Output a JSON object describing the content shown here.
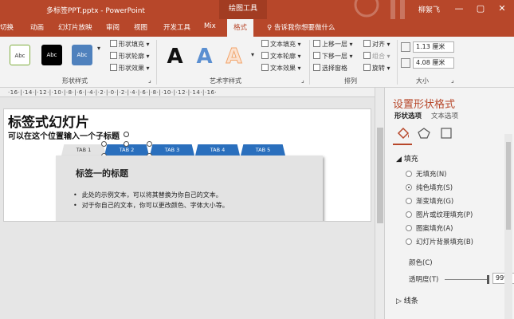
{
  "window": {
    "file_title": "多标签PPT.pptx - PowerPoint",
    "context_tab": "绘图工具",
    "user": "柳絮飞",
    "minimize": "—",
    "restore": "▢",
    "close": "✕"
  },
  "tabs": [
    {
      "label": "切换"
    },
    {
      "label": "动画"
    },
    {
      "label": "幻灯片放映"
    },
    {
      "label": "审阅"
    },
    {
      "label": "视图"
    },
    {
      "label": "开发工具"
    },
    {
      "label": "Mix"
    },
    {
      "label": "格式"
    }
  ],
  "tell_me": "告诉我你想要做什么",
  "ribbon": {
    "shape_styles": {
      "label": "形状样式",
      "swatches": [
        {
          "text": "Abc",
          "bg": "#ffffff",
          "fg": "#333333",
          "border": "#7fae3f"
        },
        {
          "text": "Abc",
          "bg": "#000000",
          "fg": "#ffffff",
          "border": "#000000"
        },
        {
          "text": "Abc",
          "bg": "#4f81bd",
          "fg": "#ffffff",
          "border": "#3a66a0"
        }
      ],
      "fill": "形状填充",
      "outline": "形状轮廓",
      "effects": "形状效果"
    },
    "art_styles": {
      "label": "艺术字样式",
      "letters": [
        {
          "text": "A",
          "color": "#111111"
        },
        {
          "text": "A",
          "color": "#5b8fd1"
        },
        {
          "text": "A",
          "color": "#f2a46b"
        }
      ],
      "text_fill": "文本填充",
      "text_outline": "文本轮廓",
      "text_effects": "文本效果"
    },
    "arrange": {
      "label": "排列",
      "bring_forward": "上移一层",
      "send_backward": "下移一层",
      "selection_pane": "选择窗格",
      "align": "对齐",
      "group": "组合",
      "rotate": "旋转"
    },
    "size": {
      "label": "大小",
      "height": "1.13 厘米",
      "width": "4.08 厘米"
    }
  },
  "ruler": "·16·|·14·|·12·|·10·|·8·|·6·|·4·|·2·|·0·|·2·|·4·|·6·|·8·|·10·|·12·|·14·|·16·",
  "slide": {
    "title": "标签式幻灯片",
    "subtitle": "可以在这个位置输入一个子标题",
    "tabs": [
      "TAB 1",
      "TAB 2",
      "TAB 3",
      "TAB 4",
      "TAB 5"
    ],
    "panel_title": "标签一的标题",
    "bullets": [
      "此处的示例文本，可以将其替换为你自己的文本。",
      "对于你自己的文本，你可以更改颜色、字体大小等。"
    ]
  },
  "pane": {
    "title": "设置形状格式",
    "tab_shape": "形状选项",
    "tab_text": "文本选项",
    "fill_header": "填充",
    "fill_options": [
      {
        "label": "无填充(N)",
        "selected": false
      },
      {
        "label": "纯色填充(S)",
        "selected": true
      },
      {
        "label": "渐变填充(G)",
        "selected": false
      },
      {
        "label": "图片或纹理填充(P)",
        "selected": false
      },
      {
        "label": "图案填充(A)",
        "selected": false
      },
      {
        "label": "幻灯片背景填充(B)",
        "selected": false
      }
    ],
    "color_label": "颜色(C)",
    "transparency_label": "透明度(T)",
    "transparency_value": "99%",
    "line_header": "线条"
  },
  "colors": {
    "accent": "#b7472a",
    "tab_blue": "#2a6fbd"
  }
}
